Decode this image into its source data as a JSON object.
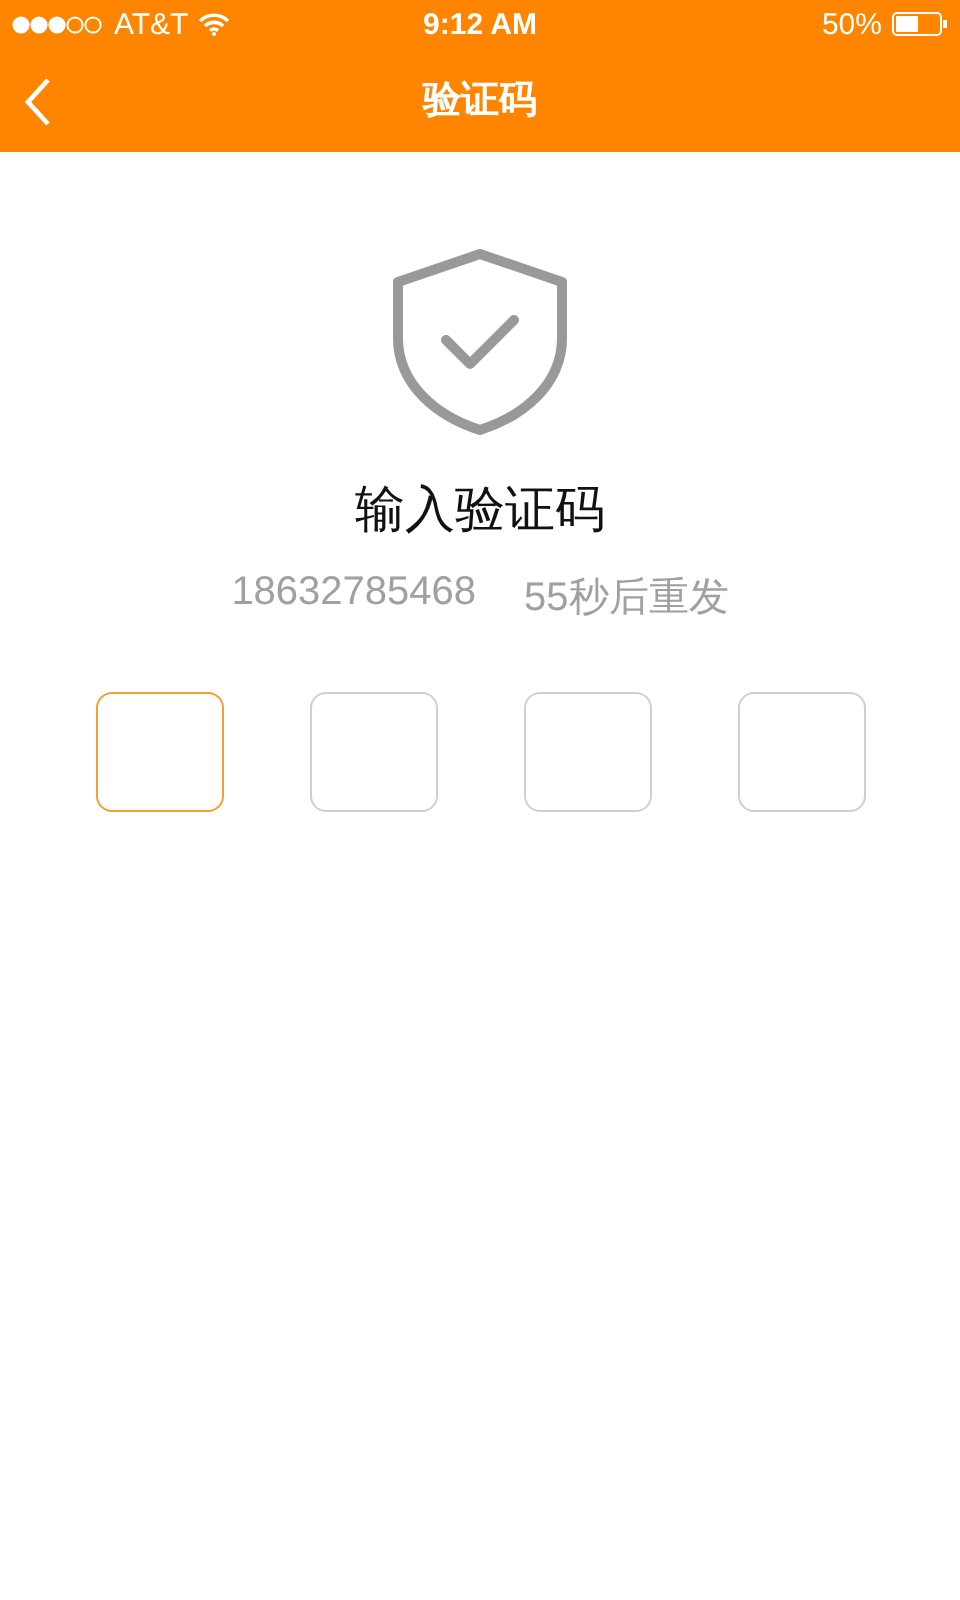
{
  "status_bar": {
    "carrier": "AT&T",
    "time": "9:12 AM",
    "battery": "50%"
  },
  "nav_bar": {
    "title": "验证码"
  },
  "heading": "输入验证码",
  "phone": "18632785468",
  "resend": "55秒后重发",
  "code_boxes": [
    {
      "selected": true
    },
    {
      "selected": false
    },
    {
      "selected": false
    },
    {
      "selected": false
    }
  ]
}
